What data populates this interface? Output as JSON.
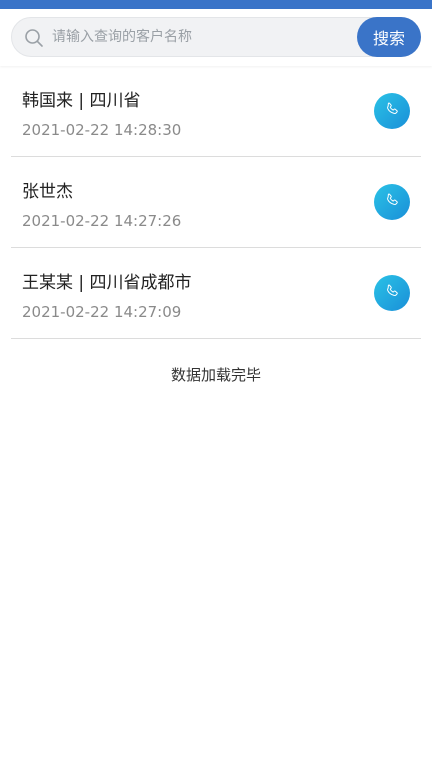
{
  "search": {
    "placeholder": "请输入查询的客户名称",
    "value": "",
    "button_label": "搜索"
  },
  "customers": [
    {
      "title": "韩国来 | 四川省",
      "time": "2021-02-22 14:28:30"
    },
    {
      "title": "张世杰",
      "time": "2021-02-22 14:27:26"
    },
    {
      "title": "王某某 | 四川省成都市",
      "time": "2021-02-22 14:27:09"
    }
  ],
  "footer": {
    "status": "数据加载完毕"
  },
  "colors": {
    "brand": "#3a74c8",
    "call_gradient_start": "#2ac2e6",
    "call_gradient_end": "#1a8fd8"
  },
  "icons": {
    "search": "search-icon",
    "call": "phone-icon"
  }
}
